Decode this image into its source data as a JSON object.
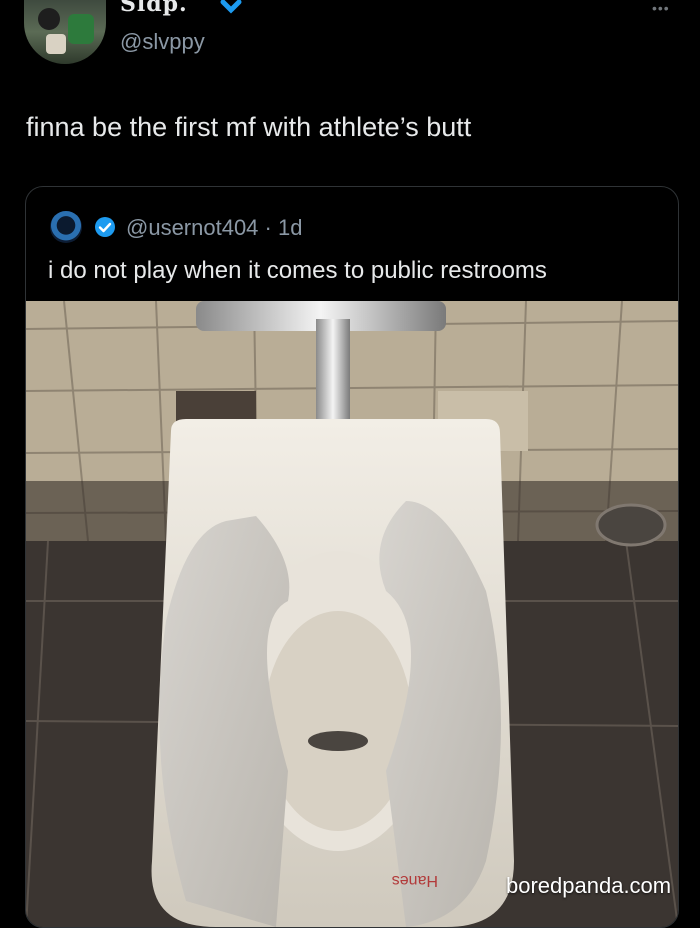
{
  "author": {
    "display_name": "Sldp.",
    "handle": "@slvppy",
    "more_icon": "more-icon"
  },
  "tweet": {
    "text": "finna be the first mf with athlete’s butt"
  },
  "quoted_tweet": {
    "handle_and_time": "@usernot404 · 1d",
    "text": "i do not play when it comes to public restrooms",
    "photo_label": "Hanes"
  },
  "watermark": "boredpanda.com",
  "colors": {
    "background": "#000000",
    "text": "#e7e9ea",
    "secondary_text": "#8b98a5",
    "verified": "#1d9bf0",
    "border": "#2f3336"
  }
}
